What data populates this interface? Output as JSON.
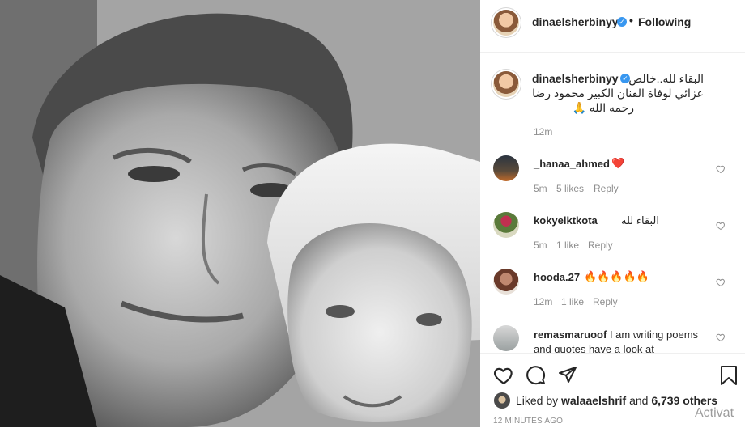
{
  "header": {
    "username": "dinaelsherbinyy",
    "separator": "•",
    "follow_label": "Following"
  },
  "caption": {
    "username": "dinaelsherbinyy",
    "line1": "البقاء لله..خالص",
    "line2": "عزائي لوفاة الفنان الكبير محمود رضا",
    "line3": "رحمه الله 🙏",
    "time": "12m"
  },
  "comments": [
    {
      "username": "_hanaa_ahmed",
      "text": "❤️",
      "time": "5m",
      "likes": "5 likes",
      "reply": "Reply"
    },
    {
      "username": "kokyelktkota",
      "text": "البقاء لله",
      "time": "5m",
      "likes": "1 like",
      "reply": "Reply"
    },
    {
      "username": "hooda.27",
      "text": "🔥🔥🔥🔥🔥",
      "time": "12m",
      "likes": "1 like",
      "reply": "Reply"
    },
    {
      "username": "remasmaruoof",
      "text": "I am writing poems and quotes have a look at",
      "time": "",
      "likes": "",
      "reply": ""
    }
  ],
  "footer": {
    "liked_by_prefix": "Liked by",
    "liked_by_user": "walaaelshrif",
    "liked_by_and": "and",
    "liked_by_others": "6,739 others",
    "timestamp": "12 MINUTES AGO"
  },
  "icons": [
    "heart-icon",
    "comment-icon",
    "share-icon",
    "bookmark-icon",
    "verified-icon"
  ],
  "colors": {
    "verified": "#3897f0",
    "heart_red": "#ed4956",
    "muted": "#8e8e8e"
  },
  "watermark": "Activat"
}
